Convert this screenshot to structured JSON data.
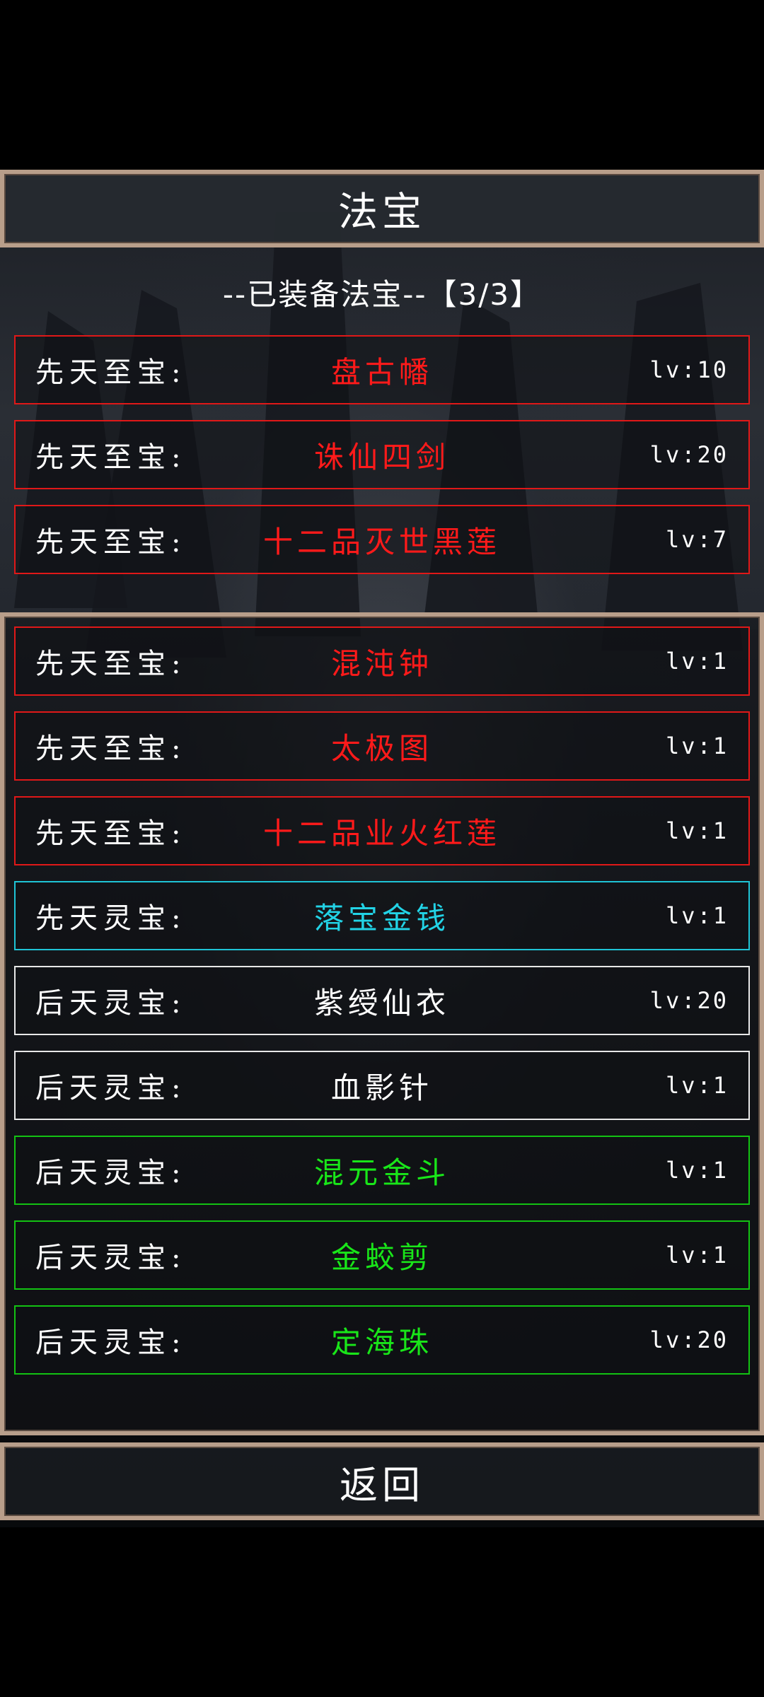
{
  "title": "法宝",
  "equipped_header": "--已装备法宝--【3/3】",
  "equipped": [
    {
      "category": "先天至宝:",
      "name": "盘古幡",
      "level": "lv:10",
      "color": "#ff1a1a"
    },
    {
      "category": "先天至宝:",
      "name": "诛仙四剑",
      "level": "lv:20",
      "color": "#ff1a1a"
    },
    {
      "category": "先天至宝:",
      "name": "十二品灭世黑莲",
      "level": "lv:7",
      "color": "#ff1a1a"
    }
  ],
  "inventory": [
    {
      "category": "先天至宝:",
      "name": "混沌钟",
      "level": "lv:1",
      "color": "#ff1a1a"
    },
    {
      "category": "先天至宝:",
      "name": "太极图",
      "level": "lv:1",
      "color": "#ff1a1a"
    },
    {
      "category": "先天至宝:",
      "name": "十二品业火红莲",
      "level": "lv:1",
      "color": "#ff1a1a"
    },
    {
      "category": "先天灵宝:",
      "name": "落宝金钱",
      "level": "lv:1",
      "color": "#22d3e6"
    },
    {
      "category": "后天灵宝:",
      "name": "紫绶仙衣",
      "level": "lv:20",
      "color": "#ffffff"
    },
    {
      "category": "后天灵宝:",
      "name": "血影针",
      "level": "lv:1",
      "color": "#ffffff"
    },
    {
      "category": "后天灵宝:",
      "name": "混元金斗",
      "level": "lv:1",
      "color": "#19e619"
    },
    {
      "category": "后天灵宝:",
      "name": "金蛟剪",
      "level": "lv:1",
      "color": "#19e619"
    },
    {
      "category": "后天灵宝:",
      "name": "定海珠",
      "level": "lv:20",
      "color": "#19e619"
    }
  ],
  "back_label": "返回"
}
